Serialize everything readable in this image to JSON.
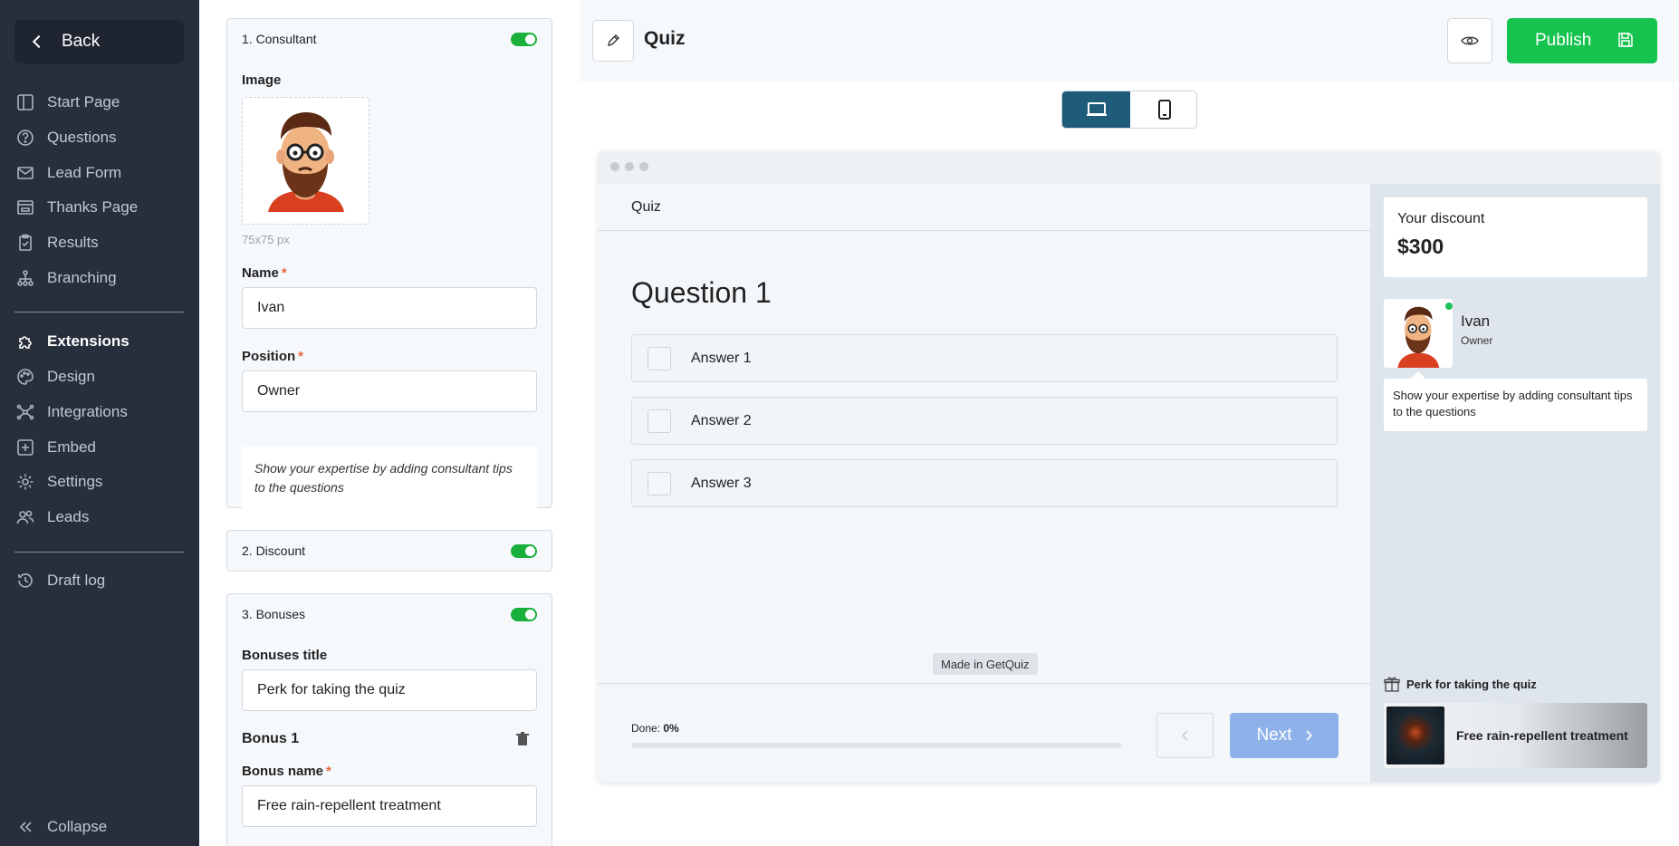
{
  "sidebar": {
    "back_label": "Back",
    "items": [
      {
        "label": "Start Page",
        "icon": "layout-icon"
      },
      {
        "label": "Questions",
        "icon": "question-circle-icon"
      },
      {
        "label": "Lead Form",
        "icon": "envelope-icon"
      },
      {
        "label": "Thanks Page",
        "icon": "inbox-icon"
      },
      {
        "label": "Results",
        "icon": "clipboard-icon"
      },
      {
        "label": "Branching",
        "icon": "sitemap-icon"
      }
    ],
    "items2": [
      {
        "label": "Extensions",
        "icon": "puzzle-icon",
        "active": true
      },
      {
        "label": "Design",
        "icon": "palette-icon"
      },
      {
        "label": "Integrations",
        "icon": "nodes-icon"
      },
      {
        "label": "Embed",
        "icon": "plus-square-icon"
      },
      {
        "label": "Settings",
        "icon": "gear-icon"
      },
      {
        "label": "Leads",
        "icon": "users-icon"
      }
    ],
    "draft_log": "Draft log",
    "collapse": "Collapse"
  },
  "config": {
    "consultant": {
      "header": "1. Consultant",
      "enabled": true,
      "image_label": "Image",
      "image_size": "75x75 px",
      "name_label": "Name",
      "name_value": "Ivan",
      "position_label": "Position",
      "position_value": "Owner",
      "tip_text": "Show your expertise by adding consultant tips to the questions"
    },
    "discount": {
      "header": "2. Discount",
      "enabled": true
    },
    "bonuses": {
      "header": "3. Bonuses",
      "enabled": true,
      "title_label": "Bonuses title",
      "title_value": "Perk for taking the quiz",
      "bonus1_heading": "Bonus 1",
      "bonus_name_label": "Bonus name",
      "bonus_name_value": "Free rain-repellent treatment"
    },
    "required_mark": "*"
  },
  "topbar": {
    "title": "Quiz",
    "publish_label": "Publish"
  },
  "preview": {
    "quiz_header": "Quiz",
    "question_title": "Question 1",
    "answers": [
      "Answer 1",
      "Answer 2",
      "Answer 3"
    ],
    "made_in": "Made in GetQuiz",
    "done_label": "Done:",
    "done_value": "0%",
    "progress": 0,
    "next_label": "Next",
    "side": {
      "discount_label": "Your discount",
      "discount_value": "$300",
      "consultant_name": "Ivan",
      "consultant_position": "Owner",
      "tip_text": "Show your expertise by adding consultant tips to the questions",
      "perk_title": "Perk for taking the quiz",
      "bonus_name": "Free rain-repellent treatment"
    }
  },
  "colors": {
    "sidebar_bg": "#272e3c",
    "publish": "#16c34f",
    "toggle_on": "#1ab03c",
    "device_active": "#1f5c7a",
    "next_button": "#8fb1ea"
  }
}
